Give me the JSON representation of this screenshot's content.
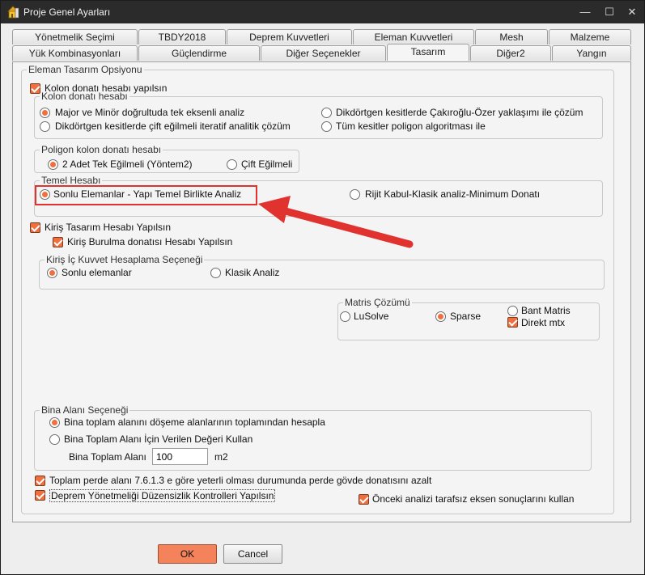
{
  "window": {
    "title": "Proje Genel Ayarları",
    "icon": "building-app-icon",
    "controls": [
      "minimize-icon",
      "maximize-icon",
      "close-icon"
    ]
  },
  "tabs": {
    "row1": [
      "Yönetmelik Seçimi",
      "TBDY2018",
      "Deprem Kuvvetleri",
      "Eleman Kuvvetleri",
      "Mesh",
      "Malzeme"
    ],
    "row2": [
      "Yük Kombinasyonları",
      "Güçlendirme",
      "Diğer Seçenekler",
      "Tasarım",
      "Diğer2",
      "Yangın"
    ],
    "active": "Tasarım"
  },
  "design": {
    "group_title": "Eleman Tasarım Opsiyonu",
    "kolon_check": "Kolon donatı hesabı yapılsın",
    "kolon_group": {
      "title": "Kolon donatı hesabı",
      "opt1": "Major ve Minör doğrultuda tek eksenli analiz",
      "opt2": "Dikdörtgen kesitlerde Çakıroğlu-Özer yaklaşımı ile çözüm",
      "opt3": "Dikdörtgen kesitlerde çift eğilmeli iteratif analitik çözüm",
      "opt4": "Tüm kesitler poligon algoritması ile"
    },
    "poligon_group": {
      "title": "Poligon kolon donatı hesabı",
      "opt1": "2 Adet Tek Eğilmeli (Yöntem2)",
      "opt2": "Çift Eğilmeli"
    },
    "temel_group": {
      "title": "Temel Hesabı",
      "opt1": "Sonlu Elemanlar - Yapı Temel Birlikte Analiz",
      "opt2": "Rijit Kabul-Klasik analiz-Minimum Donatı"
    },
    "kiris_check": "Kiriş Tasarım Hesabı Yapılsın",
    "kiris_burulma_check": "Kiriş Burulma donatısı Hesabı Yapılsın",
    "kiris_ic_group": {
      "title": "Kiriş İç Kuvvet Hesaplama Seçeneği",
      "opt1": "Sonlu elemanlar",
      "opt2": "Klasik Analiz"
    },
    "matris_group": {
      "title": "Matris Çözümü",
      "opt1": "LuSolve",
      "opt2": "Sparse",
      "opt3": "Bant Matris",
      "direkt": "Direkt mtx"
    },
    "bina_group": {
      "title": "Bina Alanı Seçeneği",
      "opt1": "Bina toplam alanını döşeme alanlarının toplamından hesapla",
      "opt2": "Bina Toplam Alanı İçin Verilen Değeri Kullan",
      "area_label": "Bina Toplam Alanı",
      "area_value": "100",
      "area_unit": "m2"
    },
    "perde_check": "Toplam perde alanı 7.6.1.3 e göre yeterli olması durumunda perde gövde donatısını azalt",
    "deprem_check": "Deprem Yönetmeliği Düzensizlik Kontrolleri Yapılsın",
    "onceki_check": "Önceki analizi tarafsız eksen sonuçlarını kullan"
  },
  "buttons": {
    "ok": "OK",
    "cancel": "Cancel"
  },
  "colors": {
    "accent": "#ef6f3e",
    "annotation": "#e0332f",
    "titlebar": "#2b2b2b"
  }
}
